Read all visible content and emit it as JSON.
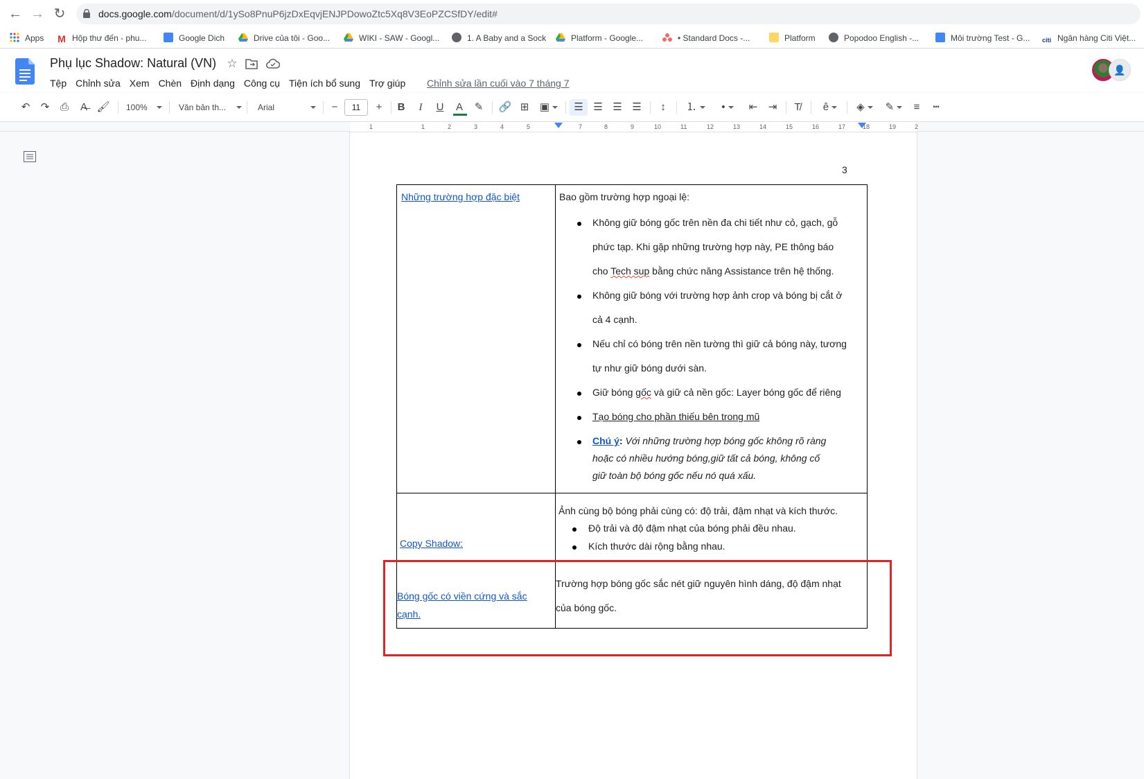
{
  "browser": {
    "url_host": "docs.google.com",
    "url_path": "/document/d/1ySo8PnuP6jzDxEqvjENJPDowoZtc5Xq8V3EoPZCSfDY/edit#"
  },
  "bookmarks": [
    {
      "label": "Apps",
      "icon": "apps-grid-icon"
    },
    {
      "label": "Hộp thư đến - phu...",
      "icon": "gmail-icon"
    },
    {
      "label": "Google Dich",
      "icon": "google-translate-icon"
    },
    {
      "label": "Drive của tôi - Goo...",
      "icon": "google-drive-icon"
    },
    {
      "label": "WIKI - SAW - Googl...",
      "icon": "google-drive-icon"
    },
    {
      "label": "1. A Baby and a Sock",
      "icon": "globe-icon"
    },
    {
      "label": "Platform - Google...",
      "icon": "google-drive-icon"
    },
    {
      "label": "• Standard Docs -...",
      "icon": "asana-icon"
    },
    {
      "label": "Platform",
      "icon": "keep-note-icon"
    },
    {
      "label": "Popodoo English -...",
      "icon": "globe-icon"
    },
    {
      "label": "Môi trường Test - G...",
      "icon": "docs-icon"
    },
    {
      "label": "Ngân hàng Citi Việt...",
      "icon": "citi-icon"
    }
  ],
  "doc": {
    "title": "Phụ lục Shadow: Natural (VN)",
    "menu": [
      "Tệp",
      "Chỉnh sửa",
      "Xem",
      "Chèn",
      "Định dạng",
      "Công cụ",
      "Tiện ích bổ sung",
      "Trợ giúp"
    ],
    "last_edit": "Chỉnh sửa lần cuối vào 7 tháng 7"
  },
  "toolbar": {
    "zoom": "100%",
    "style": "Văn bản th...",
    "font": "Arial",
    "font_size": "11",
    "decrease": "−",
    "increase": "+"
  },
  "ruler": {
    "numbers": [
      "1",
      "1",
      "2",
      "3",
      "4",
      "5",
      "7",
      "8",
      "9",
      "10",
      "11",
      "12",
      "13",
      "14",
      "15",
      "16",
      "17",
      "18",
      "19",
      "2"
    ]
  },
  "page": {
    "number": "3"
  },
  "table": {
    "row1": {
      "left": "Những trường hợp đặc biệt",
      "intro": "Bao gồm trường hợp ngoại lệ:",
      "b1_line1": "Không giữ bóng gốc trên nền đa chi tiết như cỏ, gạch, gỗ",
      "b1_line2": "phức tạp. Khi gặp những trường hợp này, PE thông báo",
      "b1_line3_pre": "cho ",
      "b1_line3_sq": "Tech sup",
      "b1_line3_post": " bằng chức năng Assistance trên hệ thống.",
      "b2_line1": "Không giữ bóng với trường hợp ảnh crop và bóng bị cắt ở",
      "b2_line2": "cả 4 cạnh.",
      "b3_line1": "Nếu chỉ có bóng trên nền tường thì giữ cả bóng này, tương",
      "b3_line2": "tự như giữ bóng dưới sàn.",
      "b4_pre": "Giữ bóng ",
      "b4_sq": "gốc",
      "b4_post": " và giữ cả nền gốc: Layer bóng gốc để riêng",
      "b5_link": "Tạo bóng cho phần thiếu bên trong mũ",
      "b6_label": "Chú ý",
      "b6_colon": ":",
      "b6_line1": " Với những trường hợp bóng gốc không rõ ràng",
      "b6_line2": "hoặc có nhiều hướng bóng,giữ tất cả bóng, không cố",
      "b6_line3": "giữ toàn bộ bóng gốc nếu nó quá xấu."
    },
    "row2": {
      "left": "Copy Shadow:",
      "intro": "Ảnh cùng bộ bóng phải cùng có: độ trải, đậm nhạt và kích thước.",
      "b1": "Độ trải và độ đậm nhạt của bóng phải đều nhau.",
      "b2": "Kích thước dài rộng bằng nhau."
    },
    "row3": {
      "left_line1": "Bóng gốc có viền cứng và sắc",
      "left_line2": "cạnh.",
      "right_line1": "Trường hợp bóng gốc sắc nét giữ nguyên hình dáng, độ đậm nhạt",
      "right_line2": "của bóng gốc."
    }
  },
  "colors": {
    "highlight_border": "#e52222",
    "link": "#1155cc",
    "text_color_bar": "#188038"
  }
}
